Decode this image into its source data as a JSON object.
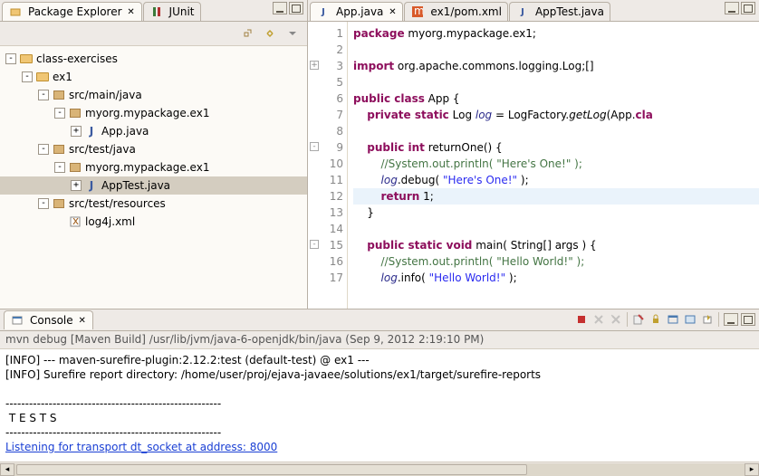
{
  "left": {
    "tabs": [
      {
        "label": "Package Explorer",
        "active": true
      },
      {
        "label": "JUnit",
        "active": false
      }
    ],
    "tree": [
      {
        "depth": 0,
        "exp": "-",
        "icon": "folder",
        "label": "class-exercises"
      },
      {
        "depth": 1,
        "exp": "-",
        "icon": "folder",
        "label": "ex1"
      },
      {
        "depth": 2,
        "exp": "-",
        "icon": "pkg",
        "label": "src/main/java"
      },
      {
        "depth": 3,
        "exp": "-",
        "icon": "pkg",
        "label": "myorg.mypackage.ex1"
      },
      {
        "depth": 4,
        "exp": "+",
        "icon": "jfile",
        "label": "App.java"
      },
      {
        "depth": 2,
        "exp": "-",
        "icon": "pkg",
        "label": "src/test/java"
      },
      {
        "depth": 3,
        "exp": "-",
        "icon": "pkg",
        "label": "myorg.mypackage.ex1"
      },
      {
        "depth": 4,
        "exp": "+",
        "icon": "jfile",
        "label": "AppTest.java",
        "sel": true
      },
      {
        "depth": 2,
        "exp": "-",
        "icon": "pkg",
        "label": "src/test/resources"
      },
      {
        "depth": 3,
        "exp": "",
        "icon": "xfile",
        "label": "log4j.xml"
      }
    ]
  },
  "editor": {
    "tabs": [
      {
        "label": "App.java",
        "active": true
      },
      {
        "label": "ex1/pom.xml",
        "active": false
      },
      {
        "label": "AppTest.java",
        "active": false
      }
    ],
    "lines": [
      {
        "n": 1,
        "html": "<span class='kw'>package</span> myorg.mypackage.ex1;"
      },
      {
        "n": 2,
        "html": ""
      },
      {
        "n": 3,
        "html": "<span class='kw'>import</span> org.apache.commons.logging.Log;[]",
        "fold": "+"
      },
      {
        "n": 5,
        "html": ""
      },
      {
        "n": 6,
        "html": "<span class='kw'>public class</span> App {"
      },
      {
        "n": 7,
        "html": "    <span class='kw'>private static</span> Log <span class='italic' style='color:#2a2a8a'>log</span> = LogFactory.<span class='italic'>getLog</span>(App.<span class='kw'>cla</span>"
      },
      {
        "n": 8,
        "html": ""
      },
      {
        "n": 9,
        "html": "    <span class='kw'>public int</span> returnOne() {",
        "fold": "-"
      },
      {
        "n": 10,
        "html": "        <span class='com'>//System.out.println( \"Here's One!\" );</span>"
      },
      {
        "n": 11,
        "html": "        <span class='italic' style='color:#2a2a8a'>log</span>.debug( <span class='str'>\"Here's One!\"</span> );"
      },
      {
        "n": 12,
        "html": "        <span class='kw'>return</span> 1;",
        "hl": true
      },
      {
        "n": 13,
        "html": "    }"
      },
      {
        "n": 14,
        "html": ""
      },
      {
        "n": 15,
        "html": "    <span class='kw'>public static void</span> main( String[] args ) {",
        "fold": "-"
      },
      {
        "n": 16,
        "html": "        <span class='com'>//System.out.println( \"Hello World!\" );</span>"
      },
      {
        "n": 17,
        "html": "        <span class='italic' style='color:#2a2a8a'>log</span>.info( <span class='str'>\"Hello World!\"</span> );"
      }
    ]
  },
  "console": {
    "tab": "Console",
    "sub": "mvn debug [Maven Build] /usr/lib/jvm/java-6-openjdk/bin/java (Sep 9, 2012 2:19:10 PM)",
    "lines": [
      "[INFO] --- maven-surefire-plugin:2.12.2:test (default-test) @ ex1 ---",
      "[INFO] Surefire report directory: /home/user/proj/ejava-javaee/solutions/ex1/target/surefire-reports",
      "",
      "-------------------------------------------------------",
      " T E S T S",
      "-------------------------------------------------------"
    ],
    "link": "Listening for transport dt_socket at address: 8000"
  }
}
